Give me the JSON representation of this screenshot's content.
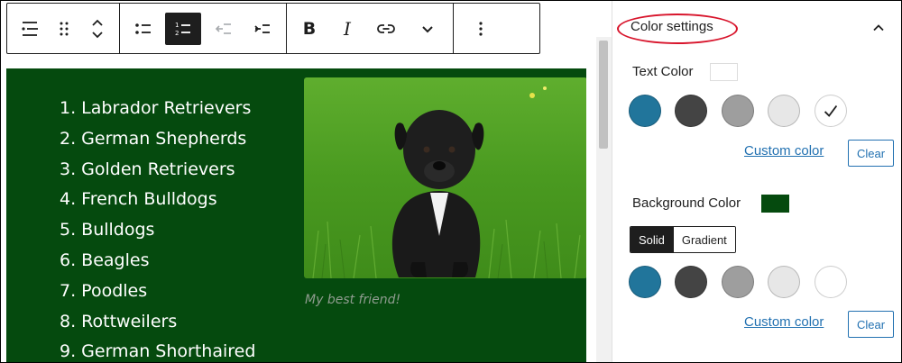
{
  "toolbar": {
    "buttons": [
      {
        "name": "list-block-icon"
      },
      {
        "name": "drag-handle-icon"
      },
      {
        "name": "move-up-down-icon"
      },
      {
        "name": "unordered-list-icon"
      },
      {
        "name": "ordered-list-icon",
        "active": true
      },
      {
        "name": "outdent-icon",
        "disabled": true
      },
      {
        "name": "indent-icon"
      },
      {
        "name": "bold-button",
        "label": "B"
      },
      {
        "name": "italic-button",
        "label": "I"
      },
      {
        "name": "link-icon"
      },
      {
        "name": "more-rich-text-icon"
      },
      {
        "name": "options-icon"
      }
    ]
  },
  "editor": {
    "background_color": "#054a0e",
    "text_color": "#ffffff",
    "list_items": [
      "1. Labrador Retrievers",
      "2. German Shepherds",
      "3. Golden Retrievers",
      "4. French Bulldogs",
      "5. Bulldogs",
      "6. Beagles",
      "7. Poodles",
      "8. Rottweilers",
      "9. German Shorthaired"
    ],
    "image_caption": "My best friend!"
  },
  "sidebar": {
    "panel_title": "Color settings",
    "text_color": {
      "label": "Text Color",
      "indicator_color": "#ffffff",
      "swatches": [
        {
          "name": "swatch-blue",
          "color": "#21759b"
        },
        {
          "name": "swatch-dark-gray",
          "color": "#444444"
        },
        {
          "name": "swatch-medium-gray",
          "color": "#9e9e9e"
        },
        {
          "name": "swatch-light-gray",
          "color": "#e7e7e7"
        },
        {
          "name": "swatch-white",
          "color": "#ffffff",
          "selected": true
        }
      ],
      "custom_label": "Custom color",
      "clear_label": "Clear"
    },
    "background_color": {
      "label": "Background Color",
      "indicator_color": "#054a0e",
      "tabs": {
        "solid": "Solid",
        "gradient": "Gradient",
        "active": "solid"
      },
      "swatches": [
        {
          "name": "swatch-blue",
          "color": "#21759b"
        },
        {
          "name": "swatch-dark-gray",
          "color": "#444444"
        },
        {
          "name": "swatch-medium-gray",
          "color": "#9e9e9e"
        },
        {
          "name": "swatch-light-gray",
          "color": "#e7e7e7"
        },
        {
          "name": "swatch-white",
          "color": "#ffffff"
        }
      ],
      "custom_label": "Custom color",
      "clear_label": "Clear"
    }
  }
}
